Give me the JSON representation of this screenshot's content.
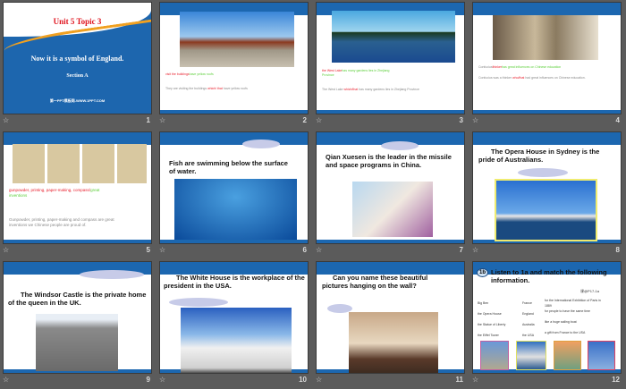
{
  "slides": [
    {
      "number": "1",
      "title": "Unit 5 Topic 3",
      "subtitle": "Now it is a symbol  of England.",
      "section": "Section A",
      "site": "第一PPT模板网-WWW.1PPT.COM"
    },
    {
      "number": "2",
      "bullet1_red": "visit the buildings",
      "bullet1_green": "have yellow roofs",
      "bullet2_a": "They are visiting the buildings ",
      "bullet2_red": "which/ that",
      "bullet2_b": " have yellow roofs"
    },
    {
      "number": "3",
      "bullet1_red": "the West Lake",
      "bullet1_green": "has  many  gardens lies in Zhejiang  Province",
      "bullet2_a": "The West Lake ",
      "bullet2_red": "which/that",
      "bullet2_b": "  has many  gardens lies in Zhejiang  Province"
    },
    {
      "number": "4",
      "bullet1_a": "Confucius",
      "bullet1_red": "thinker",
      "bullet1_green": "has great influences on Chinese education",
      "bullet2_a": "Confucius was a thinker ",
      "bullet2_red": "who/that",
      "bullet2_b": "  had great influences on Chinese education."
    },
    {
      "number": "5",
      "bullet1_red": "gunpowder, printing, paper-making, compass/",
      "bullet1_green": "great inventions",
      "bullet2": "Gunpowder, printing, paper-making and compass are great inventions            we Chinese people are proud of."
    },
    {
      "number": "6",
      "text": "Fish are swimming  below the surface of water."
    },
    {
      "number": "7",
      "text": "Qian Xuesen is the leader in the missile and space programs  in China."
    },
    {
      "number": "8",
      "text": "The Opera House in Sydney  is the pride of Australians."
    },
    {
      "number": "9",
      "text": "The Windsor  Castle is the private home of the queen in the UK."
    },
    {
      "number": "10",
      "text": "The White  House is the workplace  of the president in the USA."
    },
    {
      "number": "11",
      "text": "Can you  name these beautiful pictures hanging  on the wall?"
    },
    {
      "number": "12",
      "badge": "1b",
      "text": "Listen to 1a and match the following information.",
      "ref": "课@P17-1a",
      "col1": [
        "Big Ben",
        "the Opera House",
        "the Statue  of Liberty",
        "the Eiffel Tower"
      ],
      "col2": [
        "France",
        "England",
        "Australia",
        "the USA"
      ],
      "col3": [
        "for the  International  Exhibition of Paris in 1889",
        "for people  to have  the same time",
        "like a huge  sailing boat",
        "a gift from  France to the  USA"
      ]
    }
  ],
  "colors": {
    "slide_blue": "#1c67b0",
    "background": "#5b5b5b"
  }
}
